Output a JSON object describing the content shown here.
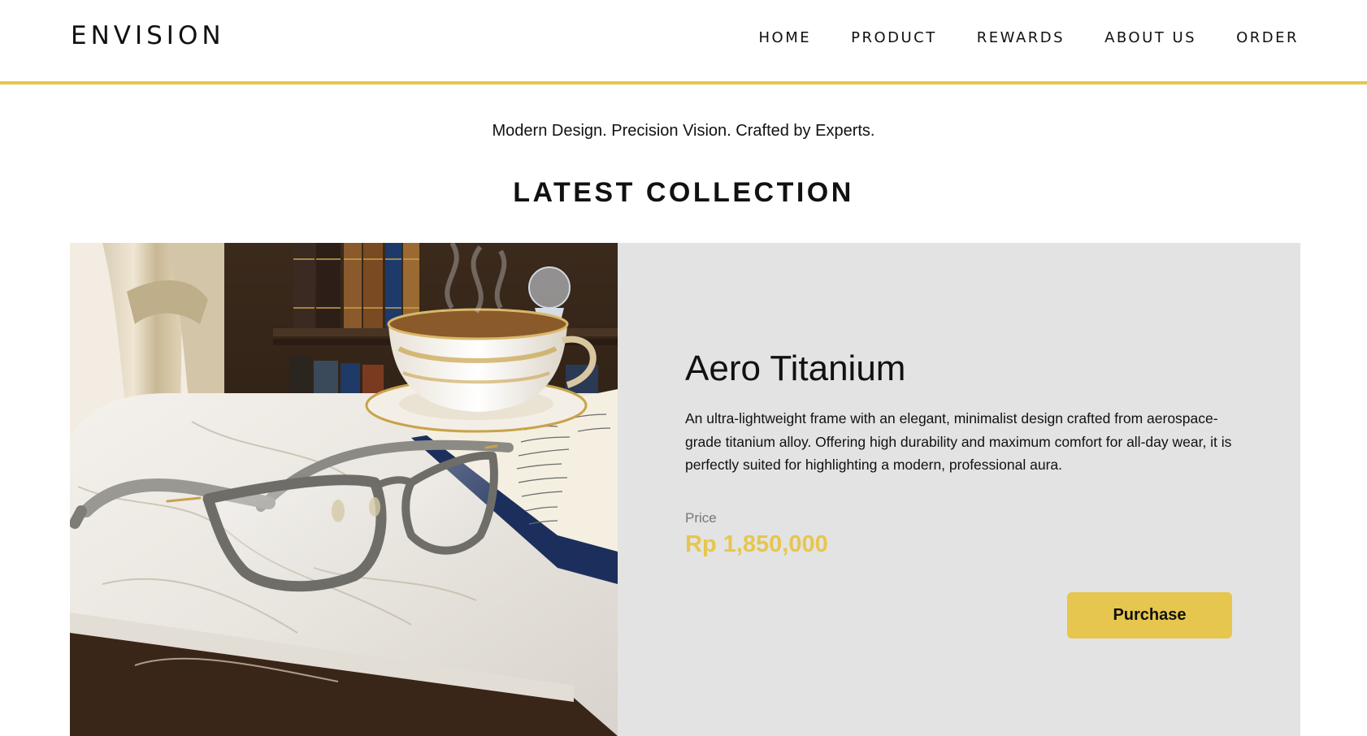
{
  "brand": {
    "logo": "ENVISION"
  },
  "nav": {
    "items": [
      {
        "label": "HOME"
      },
      {
        "label": "PRODUCT"
      },
      {
        "label": "REWARDS"
      },
      {
        "label": "ABOUT US"
      },
      {
        "label": "ORDER"
      }
    ]
  },
  "hero": {
    "tagline": "Modern Design. Precision Vision. Crafted by Experts."
  },
  "collection": {
    "title": "LATEST COLLECTION",
    "product": {
      "name": "Aero Titanium",
      "description": "An ultra-lightweight frame with an elegant, minimalist design crafted from aerospace-grade titanium alloy. Offering high durability and maximum comfort for all-day wear, it is perfectly suited for highlighting a modern, professional aura.",
      "price_label": "Price",
      "price_value": "Rp 1,850,000",
      "purchase_label": "Purchase"
    }
  },
  "colors": {
    "accent": "#e6c64e",
    "card_background": "#e3e3e3",
    "text": "#111111",
    "muted": "#777777"
  }
}
